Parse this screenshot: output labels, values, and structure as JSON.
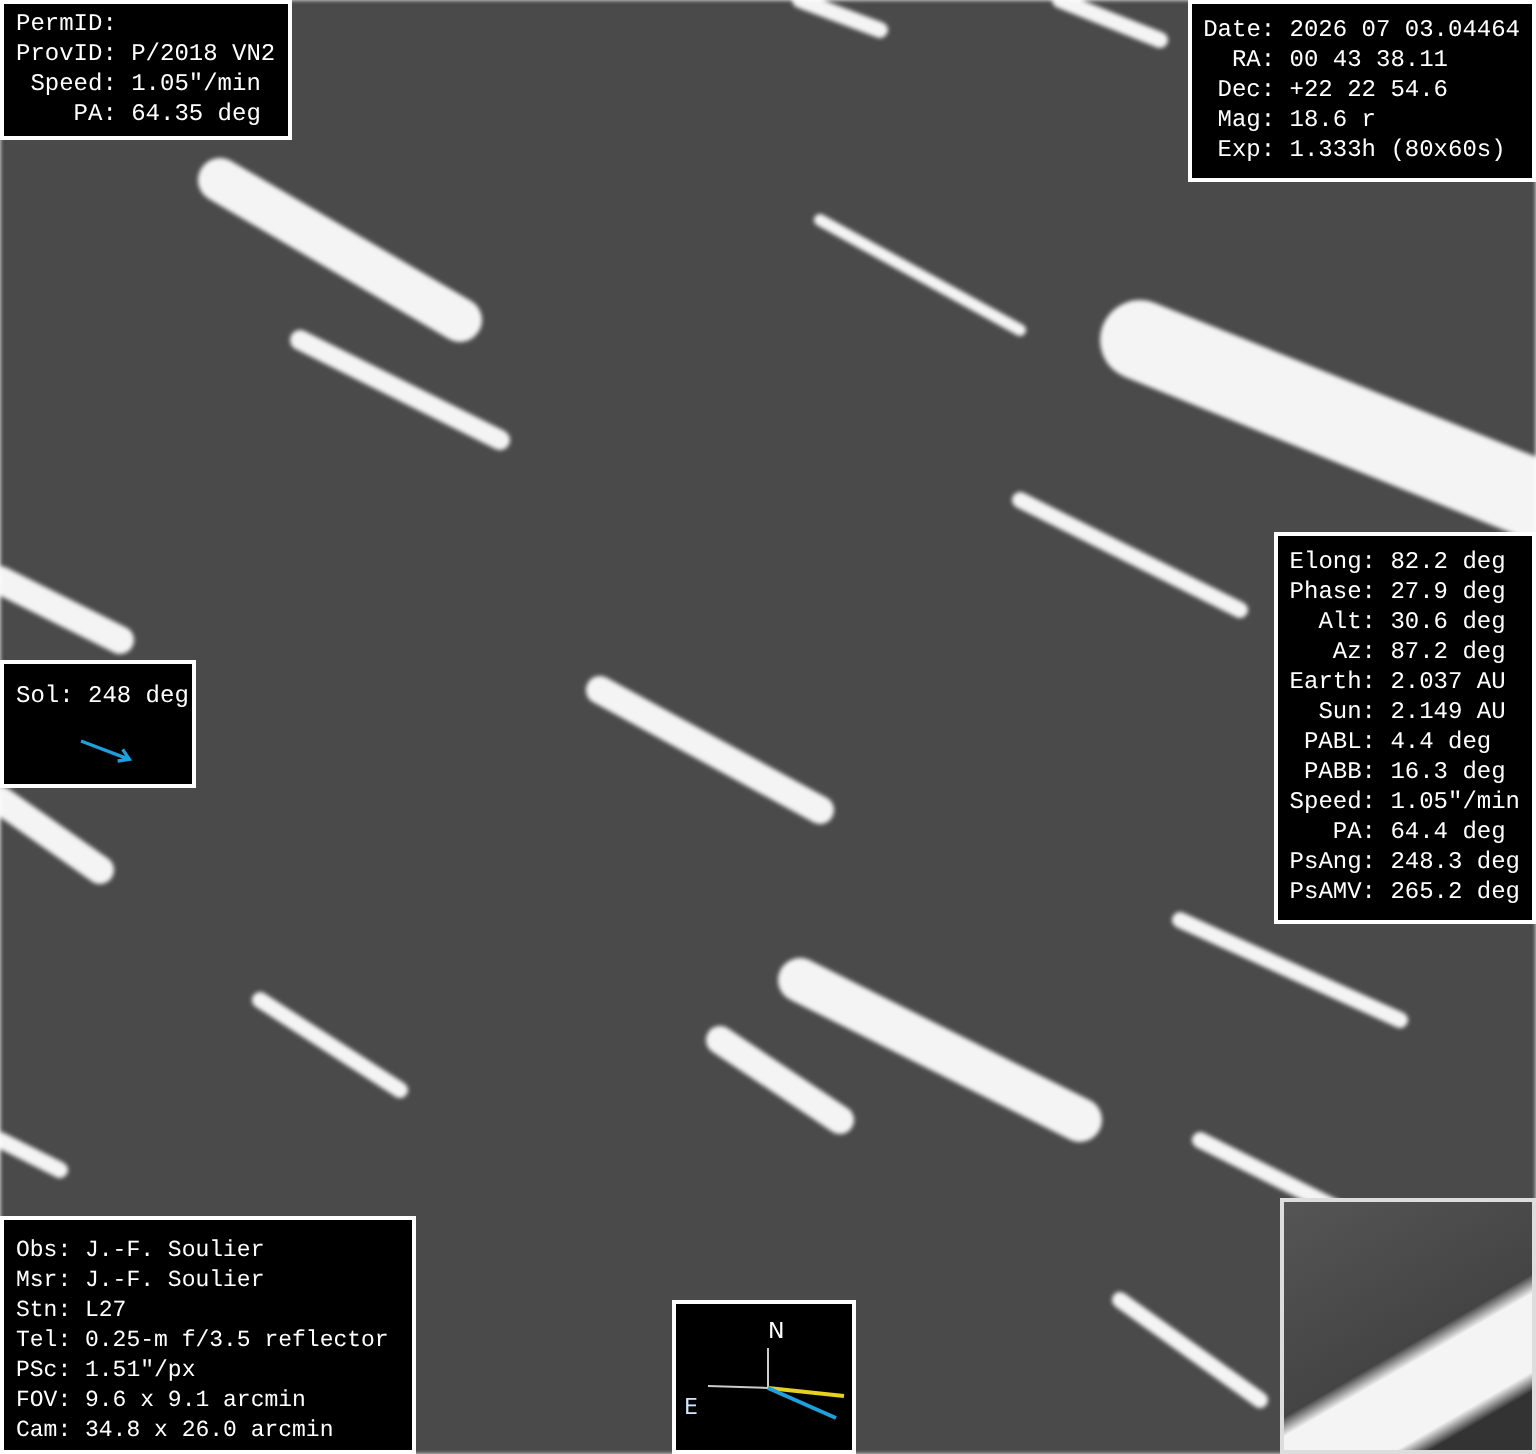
{
  "object_panel": [
    {
      "label": "PermID:"
    },
    {
      "label": "ProvID:",
      "value": "P/2018 VN2"
    },
    {
      "label": "Speed:",
      "value": "1.05\"/min"
    },
    {
      "label": "PA:",
      "value": "64.35 deg"
    }
  ],
  "observation_panel": [
    {
      "label": "Date:",
      "value": "2026 07 03.04464"
    },
    {
      "label": "RA:",
      "value": "00 43 38.11"
    },
    {
      "label": "Dec:",
      "value": "+22 22 54.6"
    },
    {
      "label": "Mag:",
      "value": "18.6 r"
    },
    {
      "label": "Exp:",
      "value": "1.333h (80x60s)"
    }
  ],
  "geometry_panel": [
    {
      "label": "Elong:",
      "value": "82.2 deg"
    },
    {
      "label": "Phase:",
      "value": "27.9 deg"
    },
    {
      "label": "Alt:",
      "value": "30.6 deg"
    },
    {
      "label": "Az:",
      "value": "87.2 deg"
    },
    {
      "label": "Earth:",
      "value": "2.037 AU"
    },
    {
      "label": "Sun:",
      "value": "2.149 AU"
    },
    {
      "label": "PABL:",
      "value": "4.4 deg"
    },
    {
      "label": "PABB:",
      "value": "16.3 deg"
    },
    {
      "label": "Speed:",
      "value": "1.05\"/min"
    },
    {
      "label": "PA:",
      "value": "64.4 deg"
    },
    {
      "label": "PsAng:",
      "value": "248.3 deg"
    },
    {
      "label": "PsAMV:",
      "value": "265.2 deg"
    }
  ],
  "sol_panel": {
    "text": "Sol: 248 deg"
  },
  "info_panel": [
    "Obs: J.-F. Soulier",
    "Msr: J.-F. Soulier",
    "Stn: L27",
    "Tel: 0.25-m f/3.5 reflector",
    "PSc: 1.51\"/px",
    "FOV: 9.6 x 9.1 arcmin",
    "Cam: 34.8 x 26.0 arcmin"
  ],
  "compass": {
    "north": "N",
    "east": "E"
  }
}
